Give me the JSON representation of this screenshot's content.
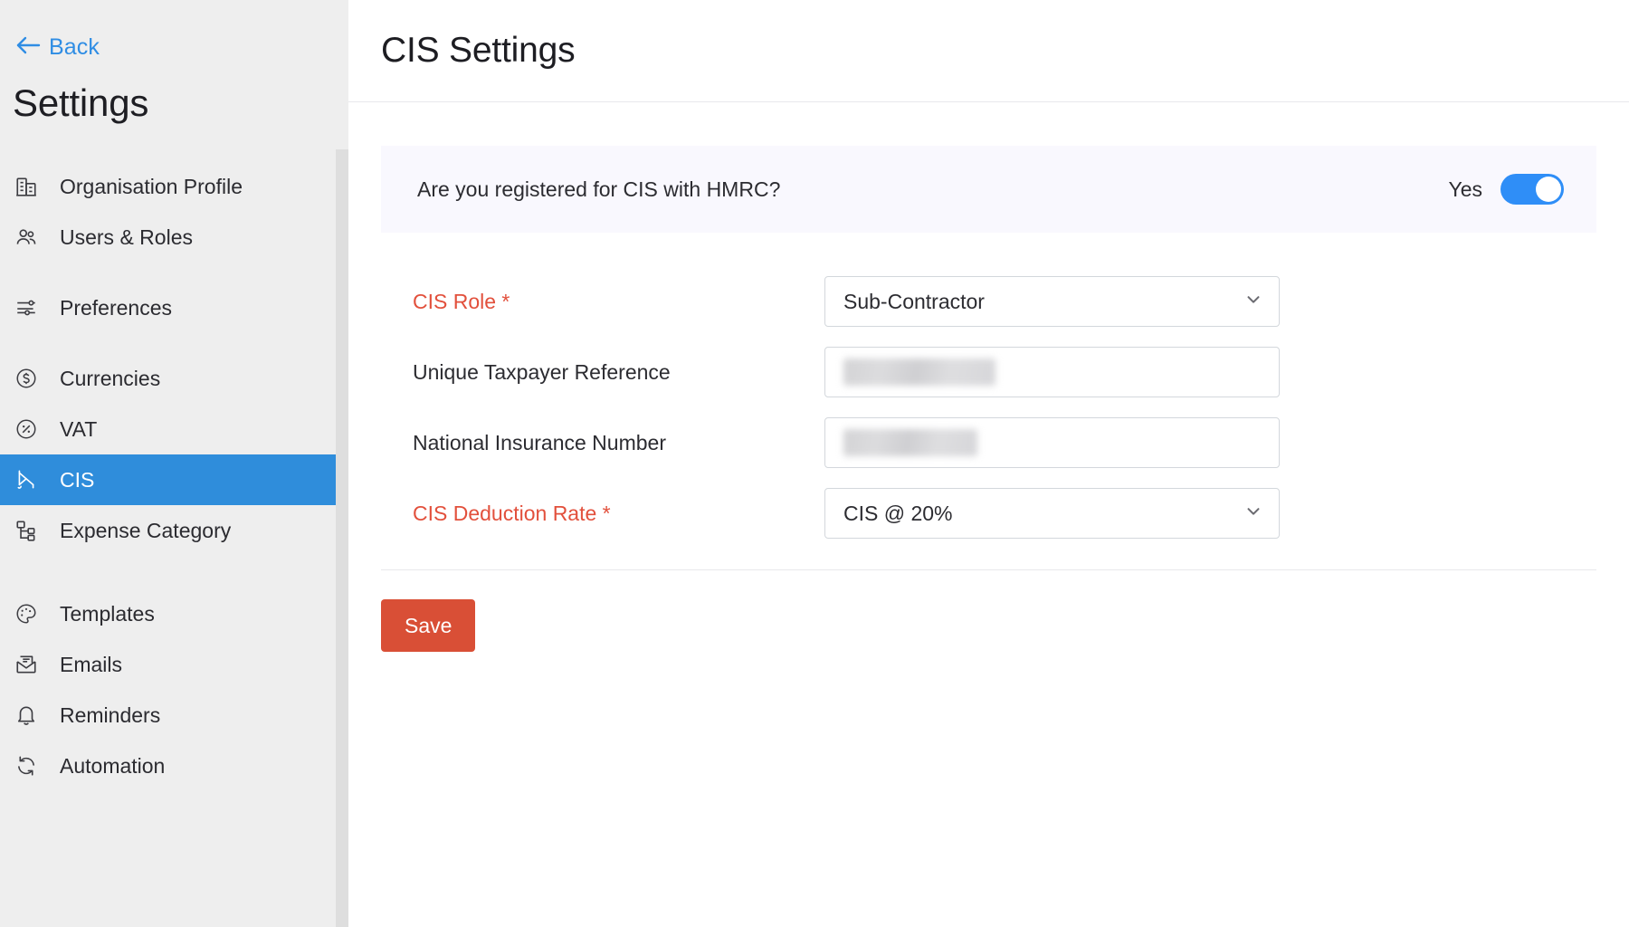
{
  "sidebar": {
    "back": {
      "label": "Back",
      "icon": "arrow-left-icon"
    },
    "title": "Settings",
    "items": [
      {
        "label": "Organisation Profile",
        "icon": "building-icon",
        "active": false
      },
      {
        "label": "Users & Roles",
        "icon": "users-icon",
        "active": false
      },
      {
        "label": "Preferences",
        "icon": "sliders-icon",
        "active": false
      },
      {
        "label": "Currencies",
        "icon": "currency-dollar-icon",
        "active": false
      },
      {
        "label": "VAT",
        "icon": "percent-circle-icon",
        "active": false
      },
      {
        "label": "CIS",
        "icon": "crane-icon",
        "active": true
      },
      {
        "label": "Expense Category",
        "icon": "hierarchy-icon",
        "active": false
      },
      {
        "label": "Templates",
        "icon": "palette-icon",
        "active": false
      },
      {
        "label": "Emails",
        "icon": "envelope-icon",
        "active": false
      },
      {
        "label": "Reminders",
        "icon": "bell-icon",
        "active": false
      },
      {
        "label": "Automation",
        "icon": "refresh-icon",
        "active": false
      }
    ]
  },
  "header": {
    "title": "CIS Settings"
  },
  "registration": {
    "question": "Are you registered for CIS with HMRC?",
    "toggle_label": "Yes",
    "toggle_on": true
  },
  "form": {
    "fields": [
      {
        "label": "CIS Role *",
        "required": true,
        "type": "select",
        "value": "Sub-Contractor",
        "name": "cis-role"
      },
      {
        "label": "Unique Taxpayer Reference",
        "required": false,
        "type": "text",
        "value": "",
        "redacted": true,
        "name": "unique-taxpayer-reference"
      },
      {
        "label": "National Insurance Number",
        "required": false,
        "type": "text",
        "value": "",
        "redacted": true,
        "name": "national-insurance-number"
      },
      {
        "label": "CIS Deduction Rate *",
        "required": true,
        "type": "select",
        "value": "CIS @ 20%",
        "name": "cis-deduction-rate"
      }
    ],
    "save_label": "Save"
  },
  "colors": {
    "accent_blue": "#2f8ddb",
    "link_blue": "#2f8de4",
    "toggle_blue": "#2f8ef7",
    "required_red": "#e2503c",
    "save_red": "#d94f36",
    "sidebar_bg": "#eeeeee",
    "banner_bg": "#f9f8fe"
  }
}
